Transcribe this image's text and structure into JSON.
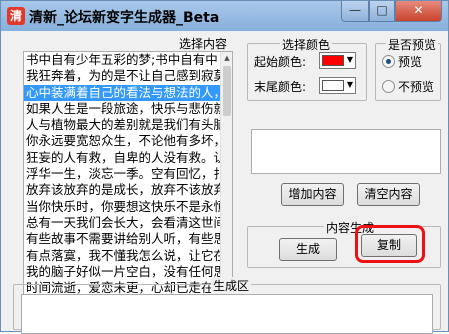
{
  "window": {
    "title": "清新_论坛新变字生成器_Beta",
    "icon_text": "清",
    "controls": {
      "minimize": "—",
      "maximize": "□",
      "close": "✕"
    }
  },
  "content_group": {
    "label": "选择内容",
    "lines": [
      "书中自有少年五彩的梦;书中自有中",
      "我狂奔着，为的是不让自己感到寂莫",
      "心中装满着自己的看法与想法的人，",
      "如果人生是一段旅途，快乐与悲伤就",
      "人与植物最大的差别就是我们有头脑",
      "你永远要宽恕众生，不论他有多坏，",
      "狂妄的人有救，自卑的人没有救。认",
      "浮华一生，淡忘一季。空有回忆，扎",
      "放弃该放弃的是成长，放弃不该放弃",
      "当你快乐时，你要想这快乐不是永恒",
      "总有一天我们会长大，会看清这世间",
      "有些故事不需要讲给别人听，有些思",
      "有点落寞，我不懂我怎么说，让它在",
      "我的脑子好似一片空白，没有任何思",
      "时间流逝，爱恋未更，心却已走在这"
    ],
    "selected_index": 2
  },
  "color_group": {
    "label": "选择颜色",
    "start_label": "起始颜色:",
    "start_color": "#ff0000",
    "end_label": "末尾颜色:",
    "end_color": "#ffffff",
    "dropdown_arrow": "▼"
  },
  "preview_group": {
    "label": "是否预览",
    "options": [
      "预览",
      "不预览"
    ],
    "selected": "预览"
  },
  "buttons": {
    "add": "增加内容",
    "clear": "清空内容",
    "generate": "生成",
    "copy": "复制"
  },
  "gen_group": {
    "label": "内容生成"
  },
  "output_group": {
    "label": "生成区"
  }
}
